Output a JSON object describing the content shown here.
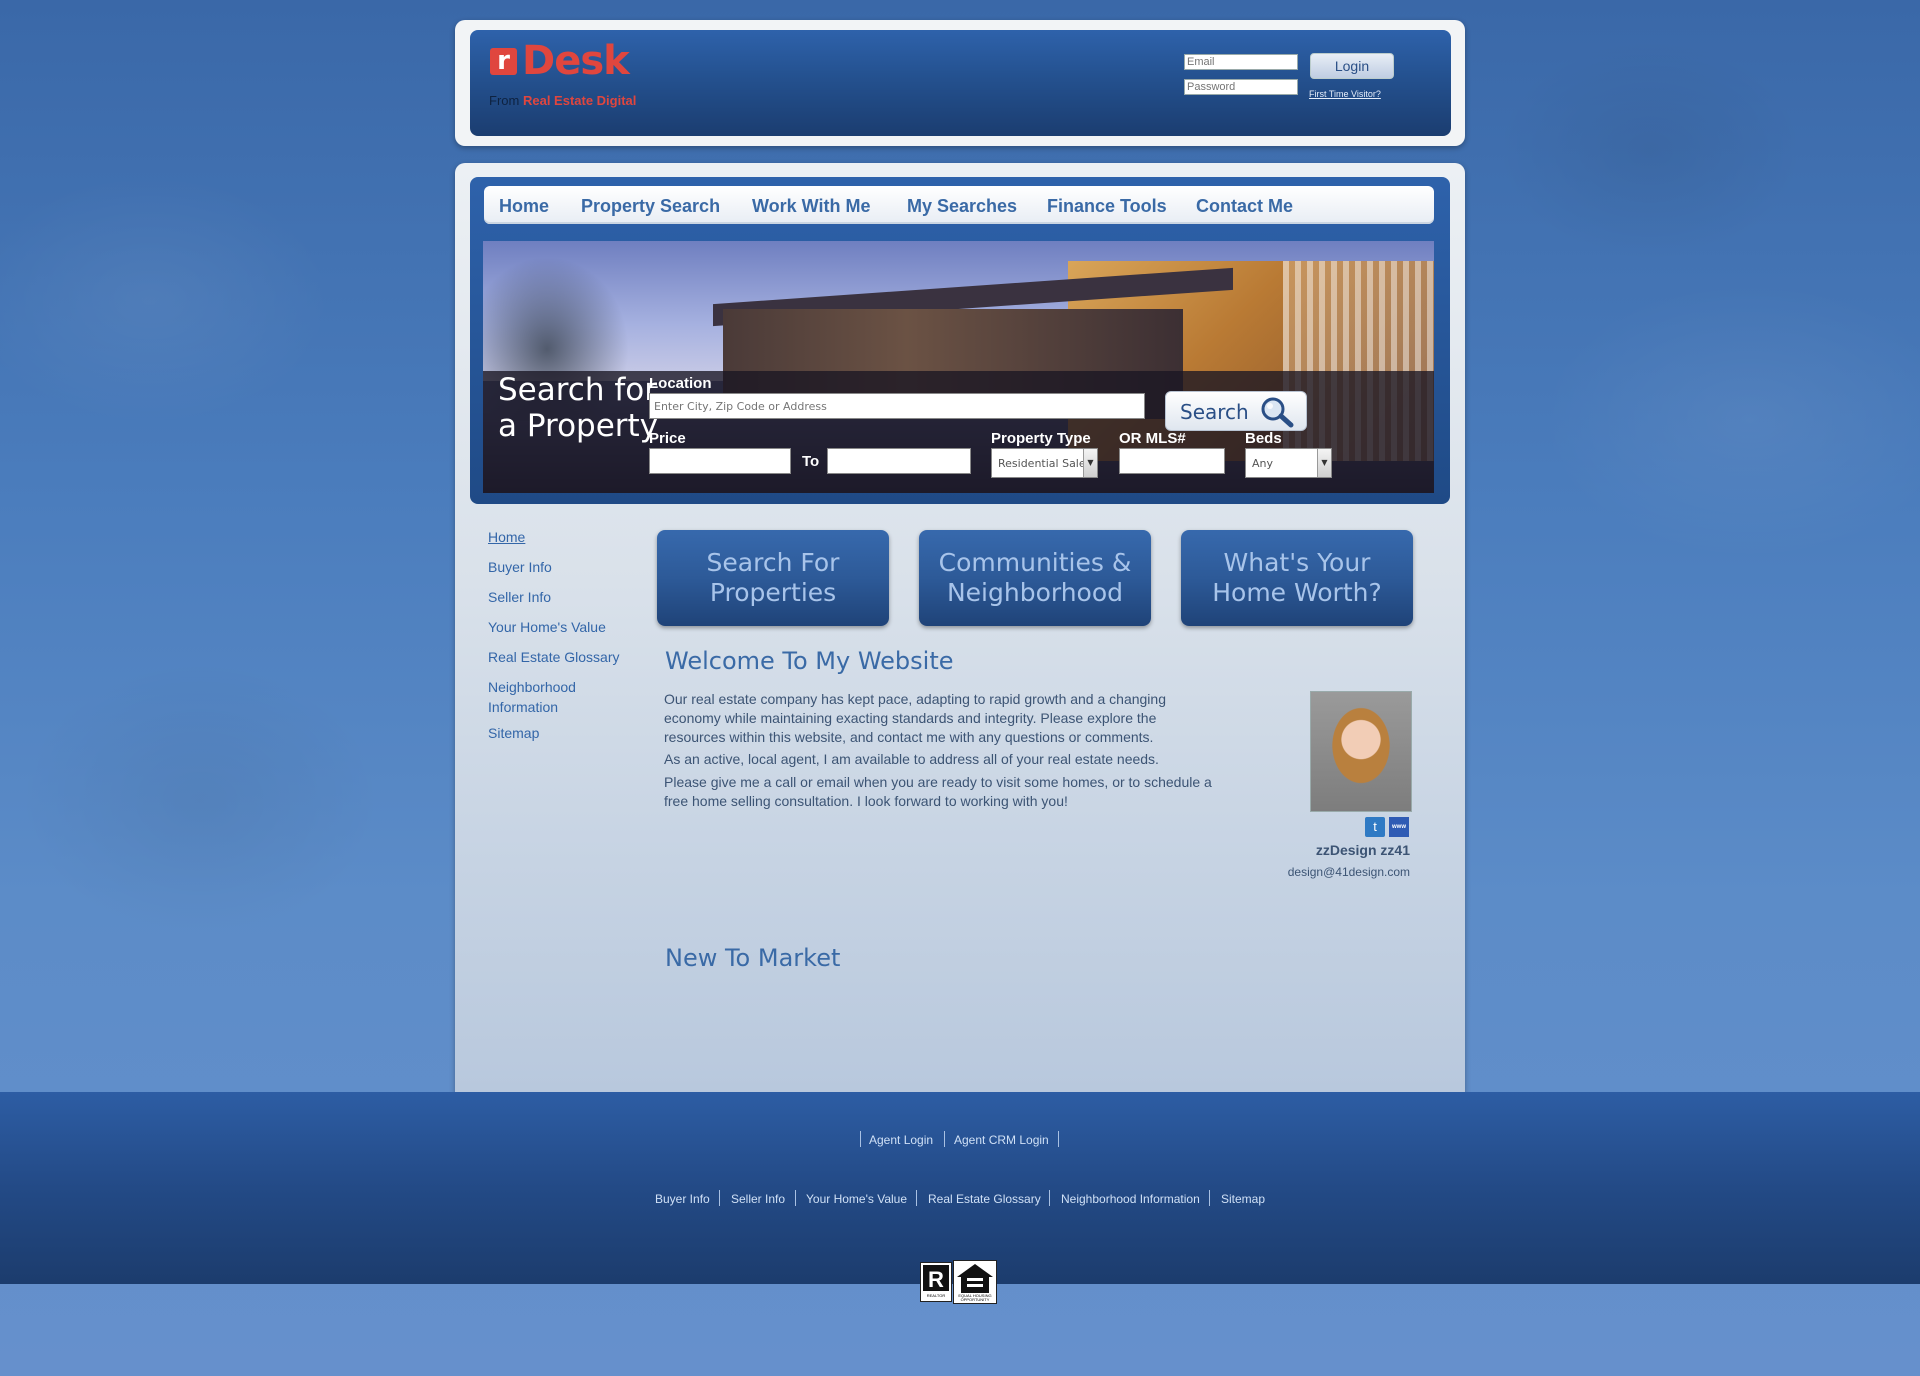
{
  "header": {
    "logo_letter": "r",
    "logo_word": "Desk",
    "logo_from": "From",
    "logo_company": "Real Estate Digital",
    "email_placeholder": "Email",
    "password_placeholder": "Password",
    "login_label": "Login",
    "first_time": "First Time Visitor?"
  },
  "nav": [
    "Home",
    "Property Search",
    "Work With Me",
    "My Searches",
    "Finance Tools",
    "Contact Me"
  ],
  "hero": {
    "title_line1": "Search for",
    "title_line2": "a Property",
    "location_label": "Location",
    "location_placeholder": "Enter City, Zip Code or Address",
    "price_label": "Price",
    "to_label": "To",
    "property_type_label": "Property Type",
    "property_type_value": "Residential Sales",
    "mls_label": "OR MLS#",
    "beds_label": "Beds",
    "beds_value": "Any",
    "search_label": "Search"
  },
  "sidebar": [
    "Home",
    "Buyer Info",
    "Seller Info",
    "Your Home's Value",
    "Real Estate Glossary",
    "Neighborhood",
    "Information",
    "Sitemap"
  ],
  "promos": [
    {
      "l1": "Search For",
      "l2": "Properties"
    },
    {
      "l1": "Communities &",
      "l2": "Neighborhood"
    },
    {
      "l1": "What's Your",
      "l2": "Home Worth?"
    }
  ],
  "welcome": {
    "heading": "Welcome To My Website",
    "p1a": "Our real estate company has kept pace, adapting to rapid growth and a changing",
    "p1b": "economy while maintaining exacting standards and integrity. Please explore the",
    "p1c": "resources within this website, and contact me with any questions or comments.",
    "p2": "As an active, local agent, I am available to address all of your real estate needs.",
    "p3a": "Please give me a call or email when you are ready to visit some homes, or to schedule a",
    "p3b": "free home selling consultation. I look forward to working with you!"
  },
  "agent": {
    "name": "zzDesign zz41",
    "email": "design@41design.com",
    "twitter_icon": "t",
    "www_icon": "www"
  },
  "market_heading": "New To Market",
  "footer": {
    "row1": [
      "Agent Login",
      "Agent CRM Login"
    ],
    "row2": [
      "Buyer Info",
      "Seller Info",
      "Your Home's Value",
      "Real Estate Glossary",
      "Neighborhood Information",
      "Sitemap"
    ],
    "realtor_small": "REALTOR",
    "equal_housing_small": "EQUAL HOUSING OPPORTUNITY"
  },
  "colors": {
    "brand_red": "#e0463e",
    "nav_blue": "#3a6aa6",
    "footer_blue": "#234a86"
  }
}
